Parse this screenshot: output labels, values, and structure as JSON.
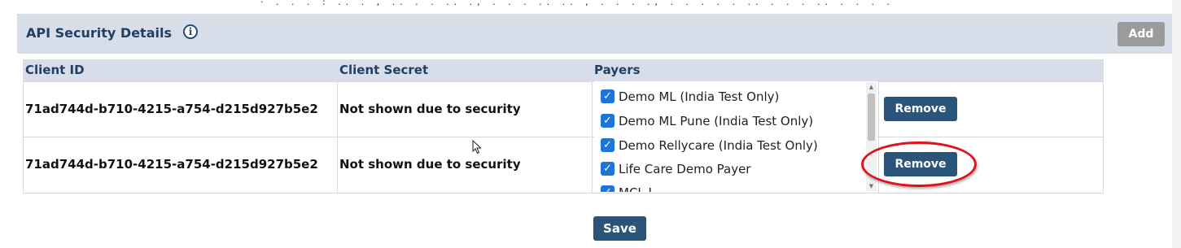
{
  "top_strip_text": "· . . . : .. . , .. . . .. ., . . . .. .. , . . . ., . . . . . .. . . . .. . . . .",
  "panel": {
    "title": "API Security Details",
    "info_icon": "i",
    "add_label": "Add"
  },
  "table": {
    "headers": {
      "client_id": "Client ID",
      "client_secret": "Client Secret",
      "payers": "Payers"
    },
    "rows": [
      {
        "client_id": "71ad744d-b710-4215-a754-d215d927b5e2",
        "client_secret": "Not shown due to security",
        "remove_label": "Remove"
      },
      {
        "client_id": "71ad744d-b710-4215-a754-d215d927b5e2",
        "client_secret": "Not shown due to security",
        "remove_label": "Remove"
      }
    ]
  },
  "payers": [
    {
      "label": "Demo ML (India Test Only)",
      "checked": true
    },
    {
      "label": "Demo ML Pune (India Test Only)",
      "checked": true
    },
    {
      "label": "Demo Rellycare (India Test Only)",
      "checked": true
    },
    {
      "label": "Life Care Demo Payer",
      "checked": true
    },
    {
      "label": "MCL I",
      "checked": true
    }
  ],
  "save_label": "Save",
  "colors": {
    "header_bg": "#d7deea",
    "primary_button": "#2a5478",
    "disabled_button": "#9b9b9b",
    "checkbox": "#1f74d8",
    "highlight": "#e0131b"
  },
  "icons": {
    "info": "info-circle-icon",
    "checkbox": "checkmark-icon",
    "scroll_up": "triangle-up-icon",
    "scroll_down": "triangle-down-icon",
    "cursor": "mouse-pointer-icon"
  }
}
